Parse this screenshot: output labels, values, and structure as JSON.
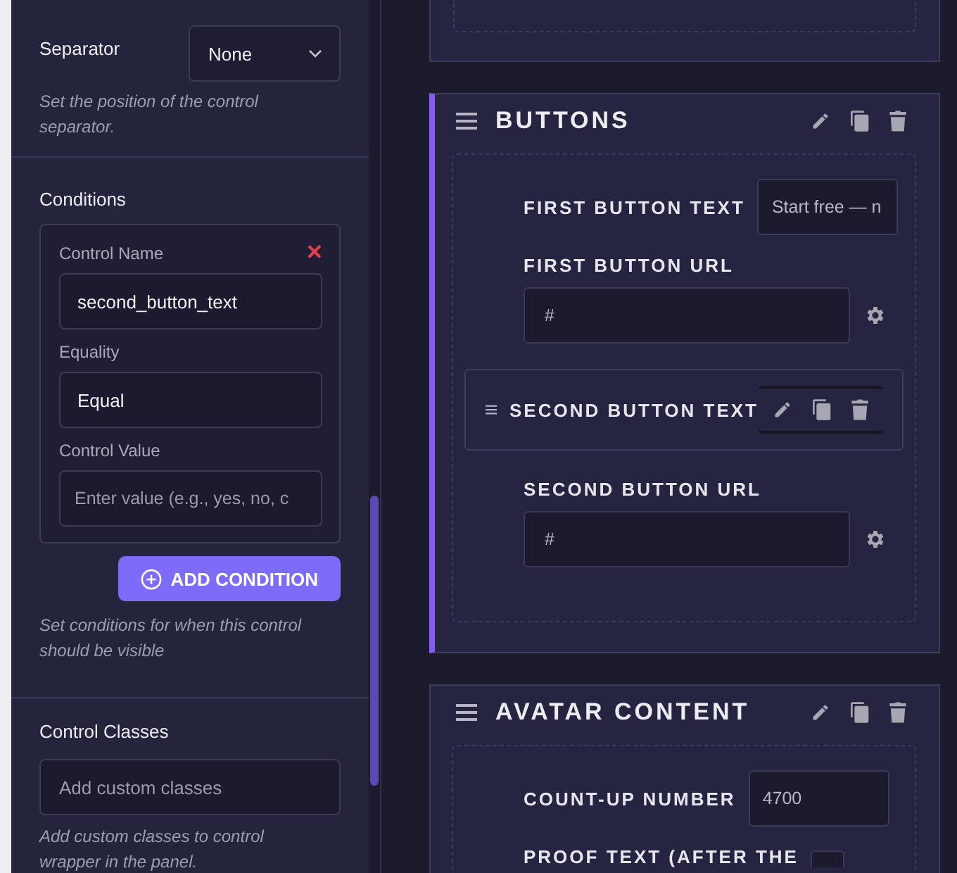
{
  "sidebar": {
    "sections": [
      {
        "kind": "select",
        "label": "Separator",
        "value": "None",
        "hint": "Set the position of the control separator."
      },
      {
        "kind": "conditions",
        "label": "Conditions",
        "conditions": [
          {
            "remove": "×",
            "fields": [
              {
                "label": "Control Name",
                "value": "second_button_text"
              },
              {
                "label": "Equality",
                "value": "Equal"
              },
              {
                "label": "Control Value",
                "placeholder": "Enter value (e.g., yes, no, c"
              }
            ]
          }
        ],
        "add_button": "ADD CONDITION",
        "hint": "Set conditions for when this control should be visible"
      },
      {
        "kind": "text",
        "label": "Control Classes",
        "placeholder": "Add custom classes",
        "hint": "Add custom classes to control wrapper in the panel."
      }
    ]
  },
  "cards": [
    {
      "title": "BUTTONS",
      "selected": true,
      "controls": [
        {
          "kind": "inline",
          "label": "FIRST BUTTON TEXT",
          "value": "Start free — n"
        },
        {
          "kind": "stacked",
          "label": "FIRST BUTTON URL",
          "value": "#"
        },
        {
          "kind": "hovered",
          "label": "SECOND BUTTON TEXT"
        },
        {
          "kind": "stacked",
          "label": "SECOND BUTTON URL",
          "value": "#"
        }
      ]
    },
    {
      "title": "AVATAR CONTENT",
      "selected": false,
      "controls": [
        {
          "kind": "inline",
          "label": "COUNT-UP NUMBER",
          "value": "4700"
        },
        {
          "kind": "inline",
          "label": "PROOF TEXT (AFTER THE"
        }
      ]
    }
  ]
}
